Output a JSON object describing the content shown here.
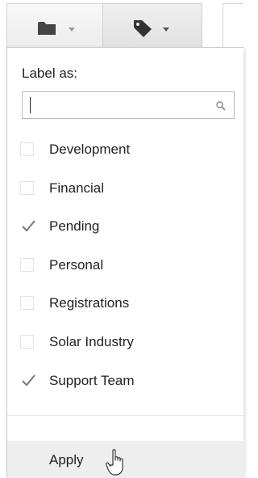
{
  "toolbar": {
    "folder_icon": "folder-icon",
    "label_icon": "tag-icon",
    "dropdown_icon": "chevron-down-icon"
  },
  "menu": {
    "title": "Label as:",
    "search": {
      "value": "",
      "placeholder": "",
      "icon": "search-icon"
    },
    "items": [
      {
        "label": "Development",
        "checked": false
      },
      {
        "label": "Financial",
        "checked": false
      },
      {
        "label": "Pending",
        "checked": true
      },
      {
        "label": "Personal",
        "checked": false
      },
      {
        "label": "Registrations",
        "checked": false
      },
      {
        "label": "Solar Industry",
        "checked": false
      },
      {
        "label": "Support Team",
        "checked": true
      }
    ],
    "apply_label": "Apply"
  },
  "colors": {
    "text": "#222222",
    "border": "#c6c6c6",
    "hover_row": "#eeeeee",
    "checkbox_border": "#e4e4e4",
    "checkmark": "#777777"
  }
}
